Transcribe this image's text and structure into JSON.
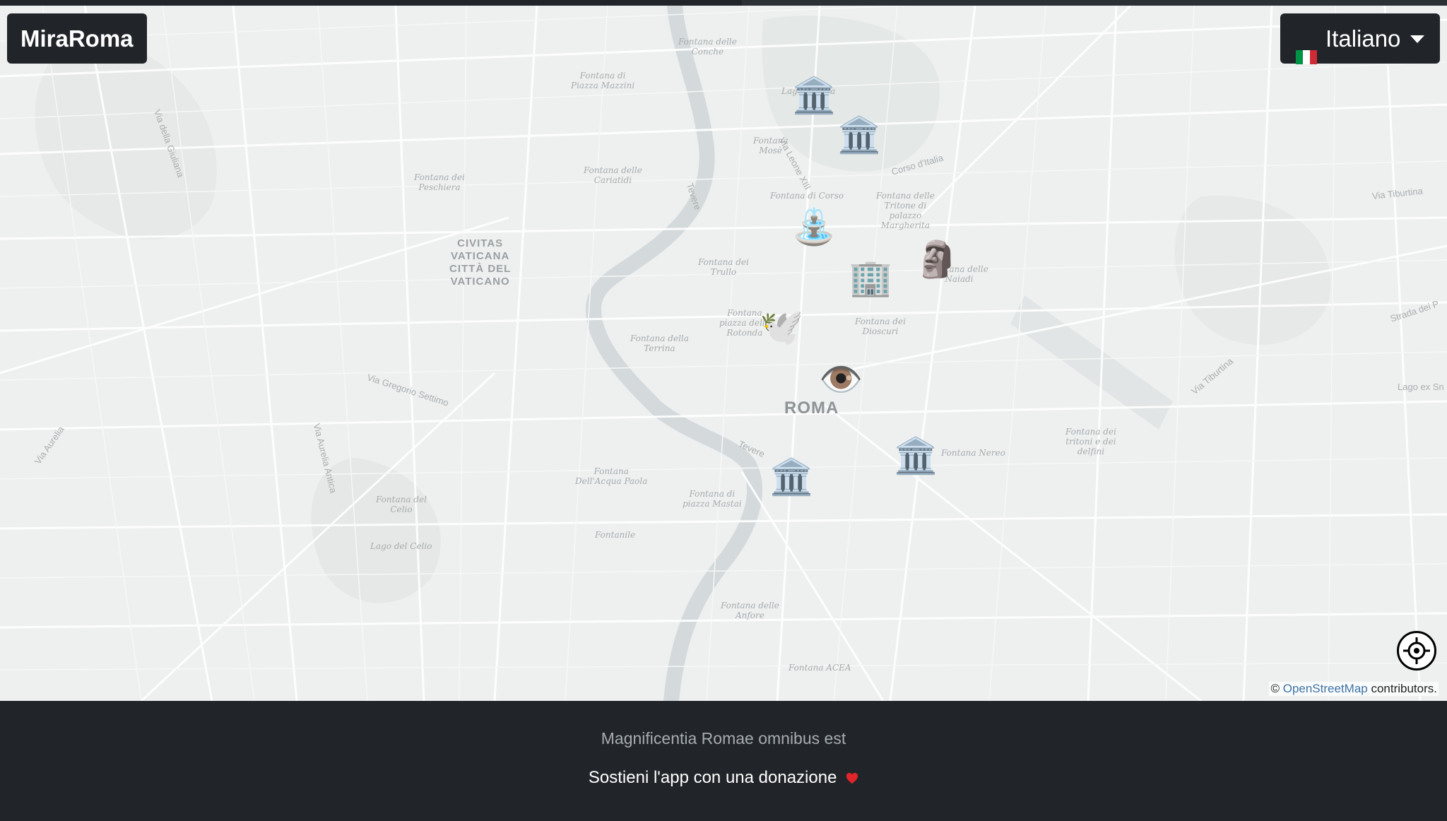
{
  "brand": {
    "title": "MiraRoma"
  },
  "language": {
    "selected": "Italiano",
    "flag_colors": [
      "#009246",
      "#ffffff",
      "#ce2b37"
    ]
  },
  "map": {
    "city_label": "ROMA",
    "area_label": "CIVITAS\nVATICANA\nCITTÀ DEL\nVATICANO",
    "place_labels": [
      "Fontana delle\nConche",
      "Fontana di\nPiazza Mazzini",
      "Fontana delle\nCariatidi",
      "Fontana dei\nPeschiera",
      "Fontana di Corso",
      "Fontana delle\nTritone di\npalazzo\nMargherita",
      "Fontana dei\nTrullo",
      "Fontana delle\nNaiadi",
      "Fontana\npiazza della\nRotonda",
      "Fontana dei\nDioscuri",
      "Fontana della\nTerrina",
      "Fontana Nereo",
      "Fontana dei\ntritoni e dei\ndelfini",
      "Fontana\nDell'Acqua Paola",
      "Fontana di\npiazza Mastai",
      "Fontana del\nCelio",
      "Fontanile",
      "Lago del Celio",
      "Fontana delle\nAnfore",
      "Fontana ACEA",
      "Fontana\nMosè",
      "Lago di Villa"
    ],
    "street_labels": [
      "Via della Giuliana",
      "Via Gregorio Settimo",
      "Via Aurelia",
      "Via Aurelia Antica",
      "Via Tiburtina",
      "Strada dei P",
      "Via Tiburtina",
      "Lago ex Sn",
      "Corso d'Italia",
      "Tevere",
      "Tevere",
      "Via Leone XIII"
    ],
    "markers": [
      {
        "name": "museum-marker-villa-borghese",
        "icon": "🏛️"
      },
      {
        "name": "museum-marker-borghese-gallery",
        "icon": "🏛️"
      },
      {
        "name": "fountain-marker-trevi",
        "icon": "⛲"
      },
      {
        "name": "moai-marker",
        "icon": "🗿"
      },
      {
        "name": "building-marker",
        "icon": "🏢"
      },
      {
        "name": "dove-marker",
        "icon": "🕊️"
      },
      {
        "name": "eye-marker-current-location",
        "icon": "👁️"
      },
      {
        "name": "museum-marker-colosseum",
        "icon": "🏛️"
      },
      {
        "name": "museum-marker-forum",
        "icon": "🏛️"
      }
    ]
  },
  "attribution": {
    "prefix": "© ",
    "link": "OpenStreetMap",
    "suffix": " contributors."
  },
  "footer": {
    "motto": "Magnificentia Romae omnibus est",
    "donate_text": "Sostieni l'app con una donazione "
  }
}
